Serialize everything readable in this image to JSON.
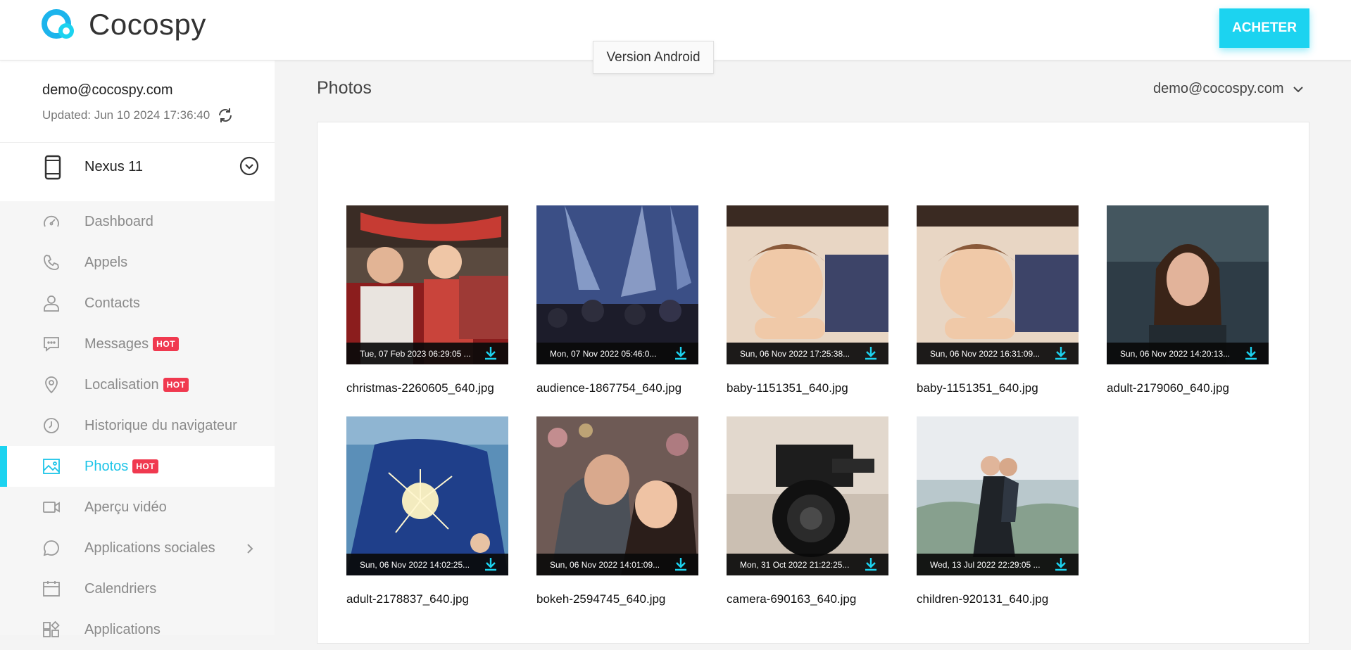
{
  "header": {
    "logo_text": "Cocospy",
    "buy_label": "ACHETER",
    "tooltip": "Version Android"
  },
  "colors": {
    "accent": "#1cd3f0",
    "hot": "#f0394f"
  },
  "sidebar": {
    "email": "demo@cocospy.com",
    "updated": "Updated: Jun 10 2024 17:36:40",
    "device": "Nexus 11",
    "hot_label": "HOT",
    "items": [
      {
        "label": "Dashboard",
        "icon": "dashboard-icon",
        "hot": false,
        "active": false
      },
      {
        "label": "Appels",
        "icon": "phone-icon",
        "hot": false,
        "active": false
      },
      {
        "label": "Contacts",
        "icon": "contact-icon",
        "hot": false,
        "active": false
      },
      {
        "label": "Messages",
        "icon": "message-icon",
        "hot": true,
        "active": false
      },
      {
        "label": "Localisation",
        "icon": "location-icon",
        "hot": true,
        "active": false
      },
      {
        "label": "Historique du navigateur",
        "icon": "clock-icon",
        "hot": false,
        "active": false
      },
      {
        "label": "Photos",
        "icon": "photo-icon",
        "hot": true,
        "active": true
      },
      {
        "label": "Aperçu vidéo",
        "icon": "video-icon",
        "hot": false,
        "active": false
      },
      {
        "label": "Applications sociales",
        "icon": "chat-icon",
        "hot": false,
        "active": false,
        "has_arrow": true
      },
      {
        "label": "Calendriers",
        "icon": "calendar-icon",
        "hot": false,
        "active": false
      },
      {
        "label": "Applications",
        "icon": "apps-icon",
        "hot": false,
        "active": false
      }
    ]
  },
  "main": {
    "title": "Photos",
    "account_select": "demo@cocospy.com",
    "photos": [
      {
        "date": "Tue, 07 Feb 2023 06:29:05 ...",
        "name": "christmas-2260605_640.jpg"
      },
      {
        "date": "Mon, 07 Nov 2022 05:46:0...",
        "name": "audience-1867754_640.jpg"
      },
      {
        "date": "Sun, 06 Nov 2022 17:25:38...",
        "name": "baby-1151351_640.jpg"
      },
      {
        "date": "Sun, 06 Nov 2022 16:31:09...",
        "name": "baby-1151351_640.jpg"
      },
      {
        "date": "Sun, 06 Nov 2022 14:20:13...",
        "name": "adult-2179060_640.jpg"
      },
      {
        "date": "Sun, 06 Nov 2022 14:02:25...",
        "name": "adult-2178837_640.jpg"
      },
      {
        "date": "Sun, 06 Nov 2022 14:01:09...",
        "name": "bokeh-2594745_640.jpg"
      },
      {
        "date": "Mon, 31 Oct 2022 21:22:25...",
        "name": "camera-690163_640.jpg"
      },
      {
        "date": "Wed, 13 Jul 2022 22:29:05 ...",
        "name": "children-920131_640.jpg"
      }
    ]
  }
}
